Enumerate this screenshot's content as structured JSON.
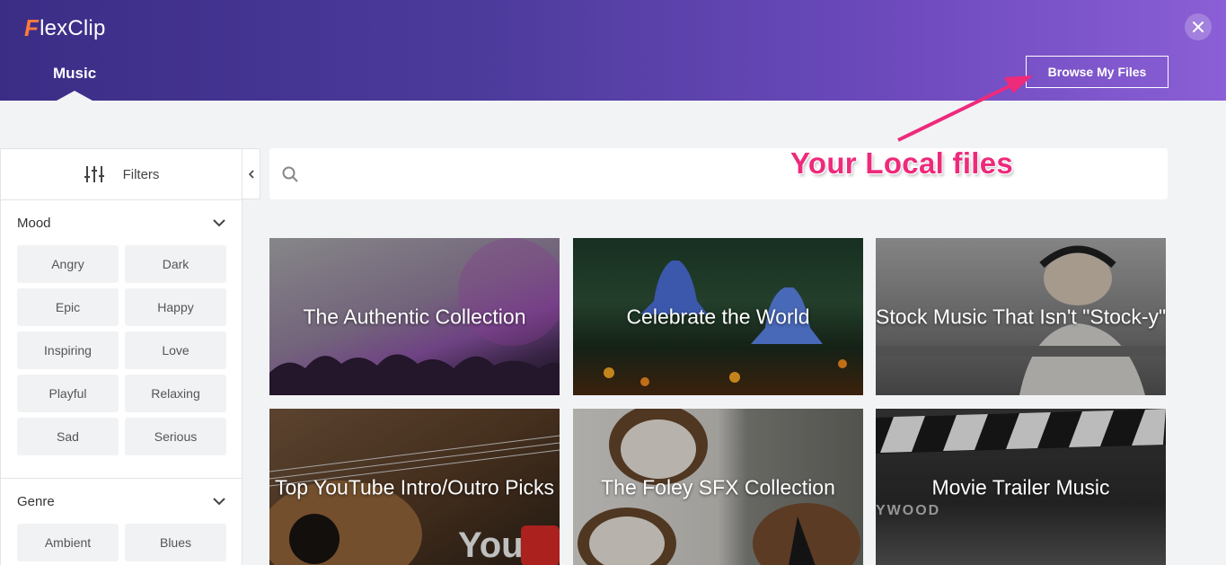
{
  "header": {
    "logo_text": "lexClip",
    "logo_mark": "F",
    "tab_label": "Music",
    "browse_label": "Browse My Files",
    "close_icon": "close-icon"
  },
  "sidebar": {
    "filters_label": "Filters",
    "mood": {
      "title": "Mood",
      "options": [
        "Angry",
        "Dark",
        "Epic",
        "Happy",
        "Inspiring",
        "Love",
        "Playful",
        "Relaxing",
        "Sad",
        "Serious"
      ]
    },
    "genre": {
      "title": "Genre",
      "options": [
        "Ambient",
        "Blues"
      ]
    }
  },
  "search": {
    "placeholder": ""
  },
  "annotation": {
    "text": "Your Local files",
    "color": "#ee2a7b"
  },
  "collections": [
    {
      "title": "The Authentic Collection"
    },
    {
      "title": "Celebrate the World"
    },
    {
      "title": "Stock Music That Isn't \"Stock-y\""
    },
    {
      "title": "Top YouTube Intro/Outro Picks"
    },
    {
      "title": "The Foley SFX Collection"
    },
    {
      "title": "Movie Trailer Music"
    }
  ],
  "colors": {
    "header_start": "#3b2d86",
    "header_end": "#8b5fd6",
    "logo_accent": "#ff7a3d"
  }
}
